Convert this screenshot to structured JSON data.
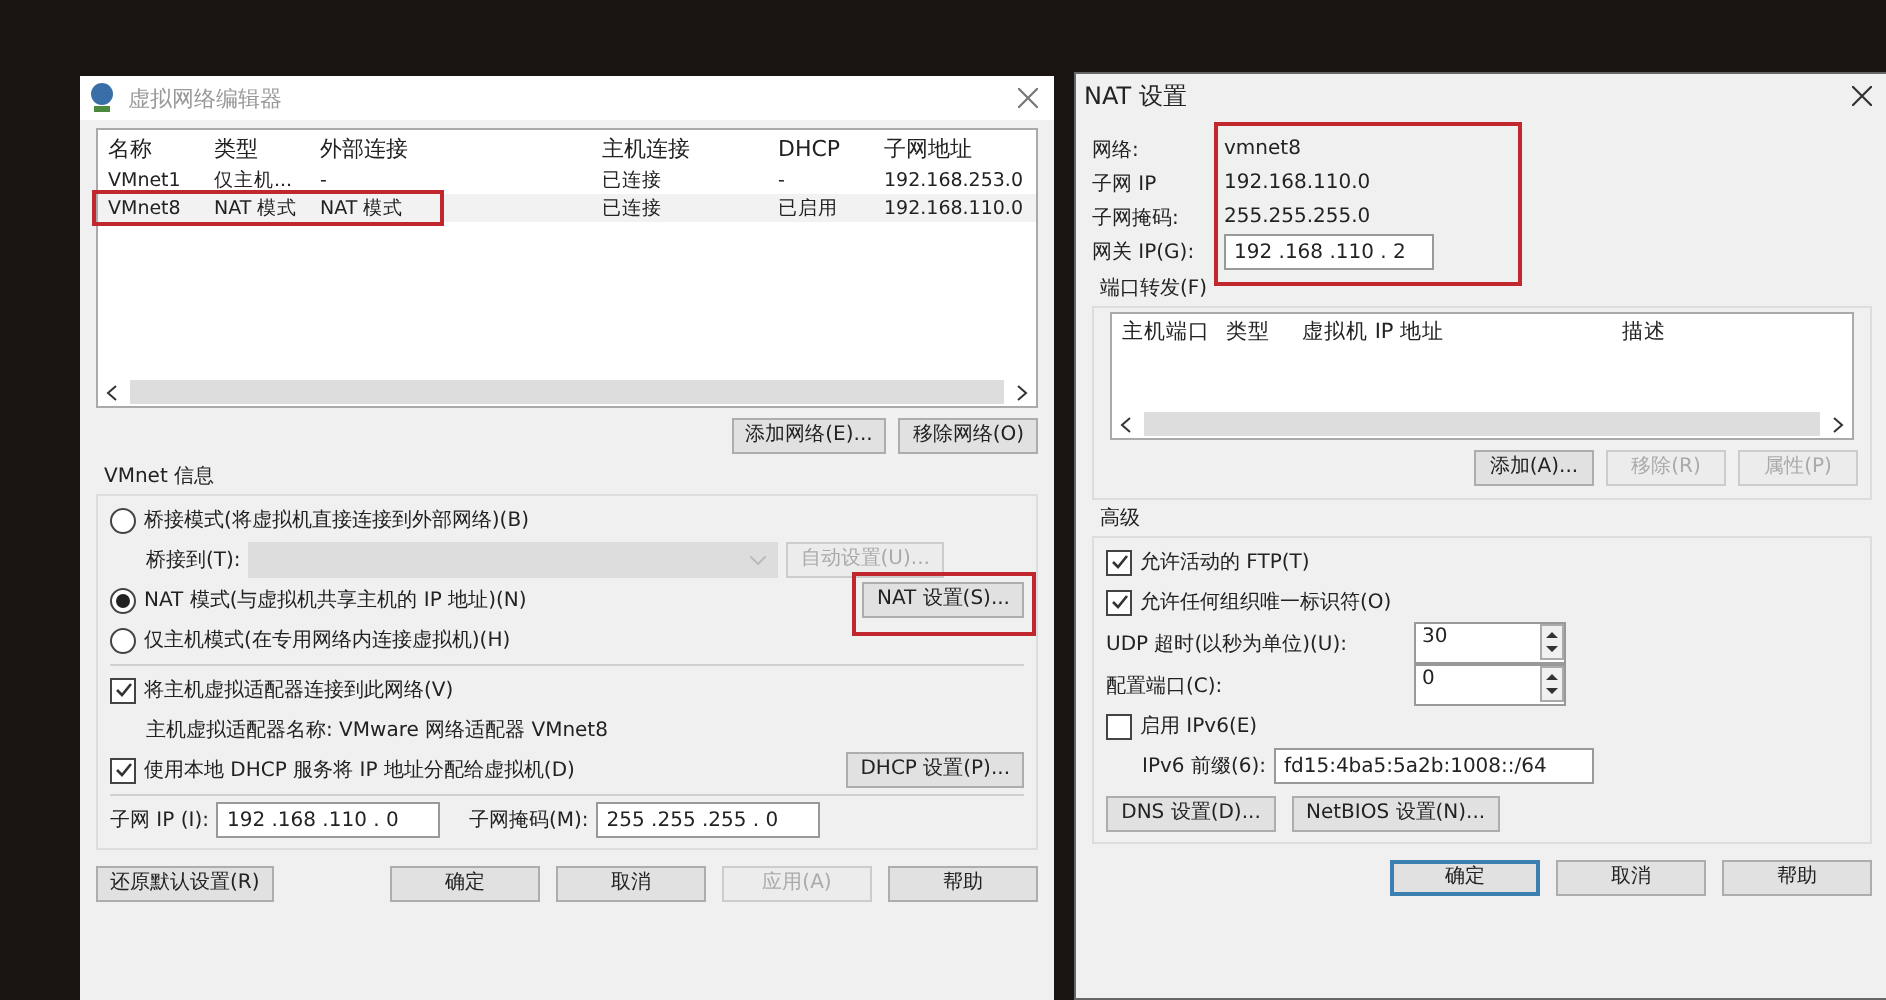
{
  "network_editor": {
    "title": "虚拟网络编辑器",
    "table": {
      "columns": [
        "名称",
        "类型",
        "外部连接",
        "主机连接",
        "DHCP",
        "子网地址"
      ],
      "rows": [
        {
          "cells": [
            "VMnet1",
            "仅主机...",
            "-",
            "已连接",
            "-",
            "192.168.253.0"
          ],
          "selected": false,
          "highlighted": false
        },
        {
          "cells": [
            "VMnet8",
            "NAT 模式",
            "NAT 模式",
            "已连接",
            "已启用",
            "192.168.110.0"
          ],
          "selected": true,
          "highlighted": true
        }
      ]
    },
    "table_buttons": [
      {
        "label": "添加网络(E)..."
      },
      {
        "label": "移除网络(O)"
      }
    ],
    "group_title": "VMnet 信息",
    "modes": [
      {
        "label": "桥接模式(将虚拟机直接连接到外部网络)(B)",
        "selected": false
      },
      {
        "label": "NAT 模式(与虚拟机共享主机的 IP 地址)(N)",
        "selected": true
      },
      {
        "label": "仅主机模式(在专用网络内连接虚拟机)(H)",
        "selected": false
      }
    ],
    "bridge_to": {
      "label": "桥接到(T):",
      "disabled": true,
      "button": "自动设置(U)..."
    },
    "nat_button": {
      "label": "NAT 设置(S)...",
      "highlighted": true
    },
    "connect_adapter": {
      "label": "将主机虚拟适配器连接到此网络(V)",
      "checked": true
    },
    "adapter_name": "主机虚拟适配器名称: VMware 网络适配器 VMnet8",
    "use_dhcp": {
      "label": "使用本地 DHCP 服务将 IP 地址分配给虚拟机(D)",
      "checked": true
    },
    "dhcp_button": "DHCP 设置(P)...",
    "subnet_ip": {
      "label": "子网 IP (I):",
      "value": "192 .168 .110 . 0"
    },
    "subnet_mask": {
      "label": "子网掩码(M):",
      "value": "255 .255 .255 . 0"
    },
    "footer_buttons": [
      {
        "label": "还原默认设置(R)",
        "disabled": false
      },
      {
        "label": "确定",
        "disabled": false
      },
      {
        "label": "取消",
        "disabled": false
      },
      {
        "label": "应用(A)",
        "disabled": true
      },
      {
        "label": "帮助",
        "disabled": false
      }
    ]
  },
  "nat_settings": {
    "title": "NAT 设置",
    "info": [
      {
        "label": "网络:",
        "value": "vmnet8"
      },
      {
        "label": "子网 IP",
        "value": "192.168.110.0"
      },
      {
        "label": "子网掩码:",
        "value": "255.255.255.0"
      }
    ],
    "gateway": {
      "label": "网关 IP(G):",
      "value": "192 .168 .110 . 2"
    },
    "info_highlighted": true,
    "port_forwarding": {
      "title": "端口转发(F)",
      "columns": [
        "主机端口",
        "类型",
        "虚拟机 IP 地址",
        "描述"
      ],
      "buttons": [
        {
          "label": "添加(A)...",
          "disabled": false
        },
        {
          "label": "移除(R)",
          "disabled": true
        },
        {
          "label": "属性(P)",
          "disabled": true
        }
      ]
    },
    "advanced": {
      "title": "高级",
      "checks": [
        {
          "label": "允许活动的 FTP(T)",
          "checked": true
        },
        {
          "label": "允许任何组织唯一标识符(O)",
          "checked": true
        }
      ],
      "spinners": [
        {
          "label": "UDP 超时(以秒为单位)(U):",
          "value": "30"
        },
        {
          "label": "配置端口(C):",
          "value": "0"
        }
      ],
      "ipv6": {
        "label": "启用 IPv6(E)",
        "checked": false
      },
      "ipv6_prefix": {
        "label": "IPv6 前缀(6):",
        "value": "fd15:4ba5:5a2b:1008::/64"
      },
      "buttons": [
        "DNS 设置(D)...",
        "NetBIOS 设置(N)..."
      ]
    },
    "footer_buttons": [
      {
        "label": "确定",
        "default": true
      },
      {
        "label": "取消",
        "default": false
      },
      {
        "label": "帮助",
        "default": false
      }
    ]
  }
}
